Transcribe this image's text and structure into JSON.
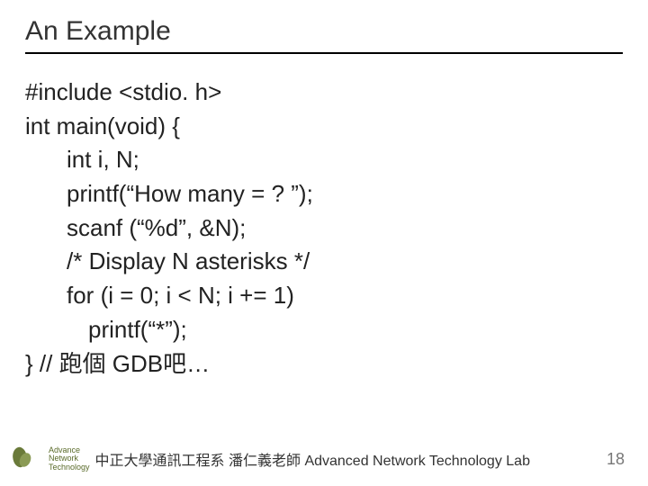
{
  "slide": {
    "title": "An Example",
    "code": {
      "l1": "#include <stdio. h>",
      "l2": "int main(void) {",
      "l3": "int i, N;",
      "l4": "printf(“How many = ? ”);",
      "l5": "scanf (“%d”, &N);",
      "l6": "/* Display N asterisks */",
      "l7": "for (i = 0;  i < N;  i += 1)",
      "l8": "printf(“*”);",
      "l9": "}  // 跑個 GDB吧…"
    },
    "footer": {
      "logo_text": "Advance\nNetwork\nTechnology",
      "center": "中正大學通訊工程系 潘仁義老師   Advanced Network Technology Lab",
      "page": "18"
    }
  }
}
